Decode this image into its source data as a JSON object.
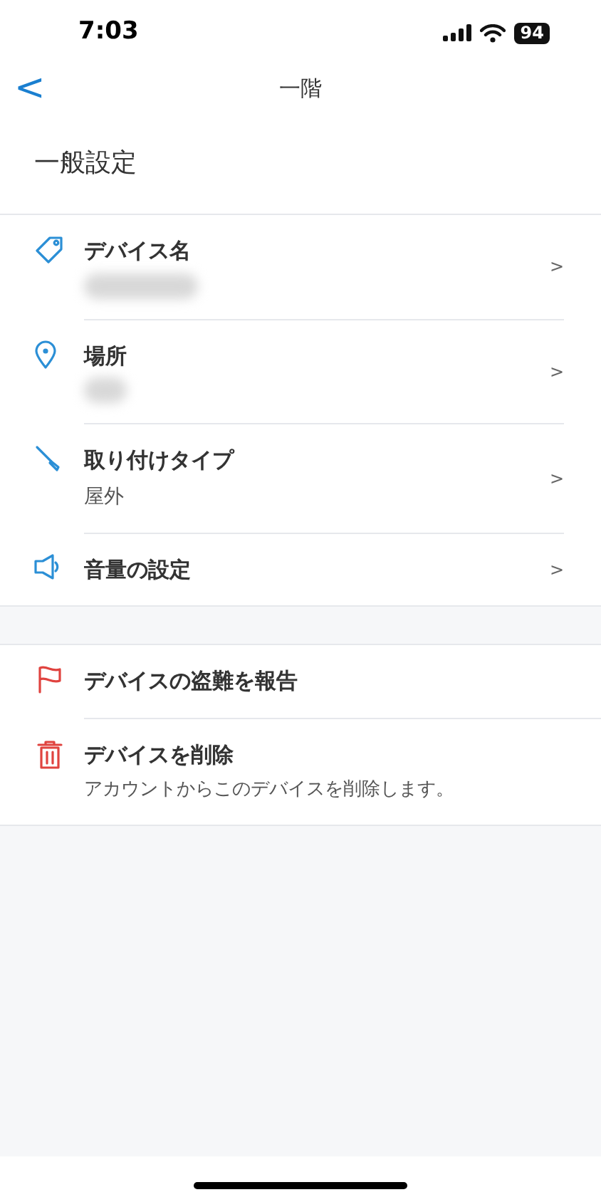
{
  "status_bar": {
    "time": "7:03",
    "battery": "94"
  },
  "nav": {
    "back": "<",
    "title": "一階"
  },
  "section_title": "一般設定",
  "settings": [
    {
      "kind": "tag",
      "label": "デバイス名",
      "value_blurred": true,
      "chevron": ">"
    },
    {
      "kind": "pin",
      "label": "場所",
      "value_blurred": true,
      "chevron": ">"
    },
    {
      "kind": "tool",
      "label": "取り付けタイプ",
      "value": "屋外",
      "chevron": ">"
    },
    {
      "kind": "speaker",
      "label": "音量の設定",
      "chevron": ">"
    }
  ],
  "actions": [
    {
      "kind": "flag",
      "label": "デバイスの盗難を報告"
    },
    {
      "kind": "trash",
      "label": "デバイスを削除",
      "description": "アカウントからこのデバイスを削除します。"
    }
  ]
}
